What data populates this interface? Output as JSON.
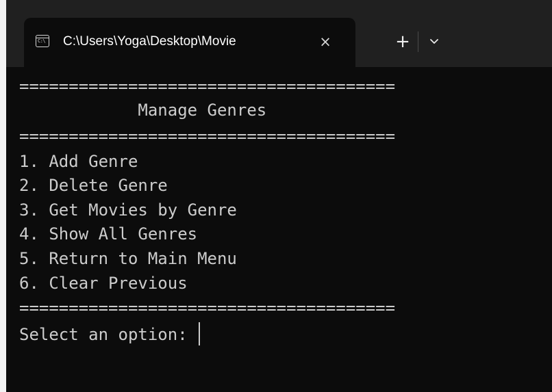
{
  "tab": {
    "icon": "cmd-icon",
    "icon_text": "C:\\",
    "title": "C:\\Users\\Yoga\\Desktop\\Movie",
    "close_icon": "close-icon",
    "new_tab_icon": "plus-icon",
    "dropdown_icon": "chevron-down-icon"
  },
  "terminal": {
    "rule": "======================================",
    "heading": "            Manage Genres",
    "menu": [
      "1. Add Genre",
      "2. Delete Genre",
      "3. Get Movies by Genre",
      "4. Show All Genres",
      "5. Return to Main Menu",
      "6. Clear Previous"
    ],
    "prompt": "Select an option: "
  },
  "colors": {
    "terminal_bg": "#0c0c0c",
    "titlebar_bg": "#202020",
    "text": "#cccccc"
  }
}
